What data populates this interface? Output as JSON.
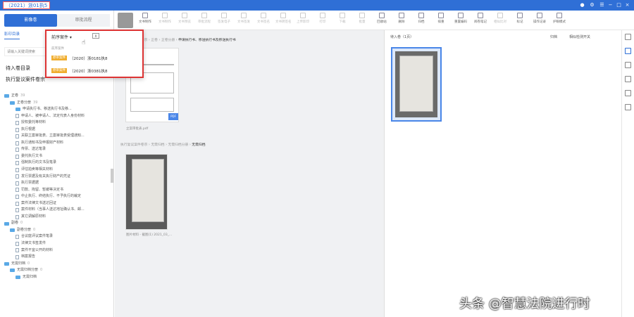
{
  "window": {
    "title": "（2021）浙01执5",
    "controls": [
      "●",
      "⚙",
      "☰",
      "−",
      "□",
      "×"
    ]
  },
  "left": {
    "tabs": [
      "影像卷",
      "审批流程"
    ],
    "subtabs": [
      "影印目录"
    ],
    "search_placeholder": "请输入关键词搜索",
    "sec1": "待入卷目录",
    "sec2": "执行复议案件卷宗",
    "tree": [
      {
        "t": "正卷",
        "i": "f",
        "l": 1,
        "c": "39"
      },
      {
        "t": "正卷分册",
        "i": "f",
        "l": 2,
        "c": "39"
      },
      {
        "t": "申请执行书、移送执行书及移...",
        "i": "f",
        "l": 3,
        "c": ""
      },
      {
        "t": "申请人、被申请人、法定代表人身份材料",
        "i": "d",
        "l": 3,
        "c": ""
      },
      {
        "t": "授权委托等材料",
        "i": "d",
        "l": 3,
        "c": ""
      },
      {
        "t": "执行根据",
        "i": "d",
        "l": 3,
        "c": ""
      },
      {
        "t": "关联立案审批表、立案审批表受理通知...",
        "i": "d",
        "l": 3,
        "c": ""
      },
      {
        "t": "执行通知书及申报财产材料",
        "i": "d",
        "l": 3,
        "c": ""
      },
      {
        "t": "传票、送达笔录",
        "i": "d",
        "l": 3,
        "c": ""
      },
      {
        "t": "委托执行文书",
        "i": "d",
        "l": 3,
        "c": ""
      },
      {
        "t": "强制执行的文书及笔录",
        "i": "d",
        "l": 3,
        "c": ""
      },
      {
        "t": "评估拍卖等相关材料",
        "i": "d",
        "l": 3,
        "c": ""
      },
      {
        "t": "发行票据及有关执行财产的凭证",
        "i": "d",
        "l": 3,
        "c": ""
      },
      {
        "t": "执行票据据",
        "i": "d",
        "l": 3,
        "c": ""
      },
      {
        "t": "罚款、拘留、暂缓等决定书",
        "i": "d",
        "l": 3,
        "c": ""
      },
      {
        "t": "中止执行、终结执行、不予执行的裁定",
        "i": "d",
        "l": 3,
        "c": ""
      },
      {
        "t": "案件法律文书送达回证",
        "i": "d",
        "l": 3,
        "c": ""
      },
      {
        "t": "案件材料（当事人送达地址确认书、邮...",
        "i": "d",
        "l": 3,
        "c": ""
      },
      {
        "t": "其它调解原材料",
        "i": "d",
        "l": 3,
        "c": ""
      },
      {
        "t": "副卷",
        "i": "f",
        "l": 1,
        "c": "0"
      },
      {
        "t": "副卷分册",
        "i": "f",
        "l": 2,
        "c": "0"
      },
      {
        "t": "合议庭评议案件笔录",
        "i": "d",
        "l": 3,
        "c": ""
      },
      {
        "t": "法律文书签发件",
        "i": "d",
        "l": 3,
        "c": ""
      },
      {
        "t": "案件不宜公开的材料",
        "i": "d",
        "l": 3,
        "c": ""
      },
      {
        "t": "档案报告",
        "i": "d",
        "l": 3,
        "c": ""
      },
      {
        "t": "无需归档",
        "i": "f",
        "l": 1,
        "c": "0"
      },
      {
        "t": "无需归档分册",
        "i": "f",
        "l": 2,
        "c": "0"
      },
      {
        "t": "无需归档",
        "i": "f",
        "l": 3,
        "c": ""
      }
    ]
  },
  "popup": {
    "title": "前序案件 ▾",
    "subtitle": "前序案件",
    "cases": [
      {
        "tag": "原审案件",
        "no": "（2020）浙0181执8"
      },
      {
        "tag": "原审案件",
        "no": "（2020）浙0381执8"
      }
    ],
    "export_icon": "excel-icon"
  },
  "toolbar": [
    {
      "l": "文书制作",
      "d": false
    },
    {
      "l": "文书制作",
      "d": true
    },
    {
      "l": "文书预览",
      "d": true
    },
    {
      "l": "审批流程",
      "d": true
    },
    {
      "l": "签发电子",
      "d": true
    },
    {
      "l": "文书签发",
      "d": true
    },
    {
      "l": "文书签名",
      "d": true
    },
    {
      "l": "文书转签名",
      "d": true
    },
    {
      "l": "上传影印",
      "d": true
    },
    {
      "l": "打印",
      "d": true
    },
    {
      "l": "下载",
      "d": true
    },
    {
      "l": "批量",
      "d": true
    },
    {
      "l": "回收站",
      "d": false
    },
    {
      "l": "删除",
      "d": false
    },
    {
      "l": "归档",
      "d": false
    },
    {
      "l": "排重",
      "d": false
    },
    {
      "l": "重置编码",
      "d": false
    },
    {
      "l": "阅卷笔记",
      "d": false
    },
    {
      "l": "相似比对",
      "d": true
    },
    {
      "l": "标记",
      "d": false
    },
    {
      "l": "操作记录",
      "d": false
    },
    {
      "l": "护眼模式",
      "d": false
    }
  ],
  "center": {
    "crumb1": [
      "执行复议案件卷宗",
      "正卷",
      "正卷分册"
    ],
    "crumb1_active": "申请执行书、移送执行书及移送执行书",
    "cap1": "立案审批表.pdf",
    "crumb2": [
      "执行复议案件卷宗",
      "无需归档",
      "无需归档分册"
    ],
    "crumb2_active": "无需归档",
    "cap2": "图片材料 - 截图(1) 2021_03_..."
  },
  "right": {
    "head": "待入卷（1页）",
    "items": [
      "归档",
      "相似检测开关"
    ]
  },
  "watermark": "头条 @智慧法院进行时"
}
